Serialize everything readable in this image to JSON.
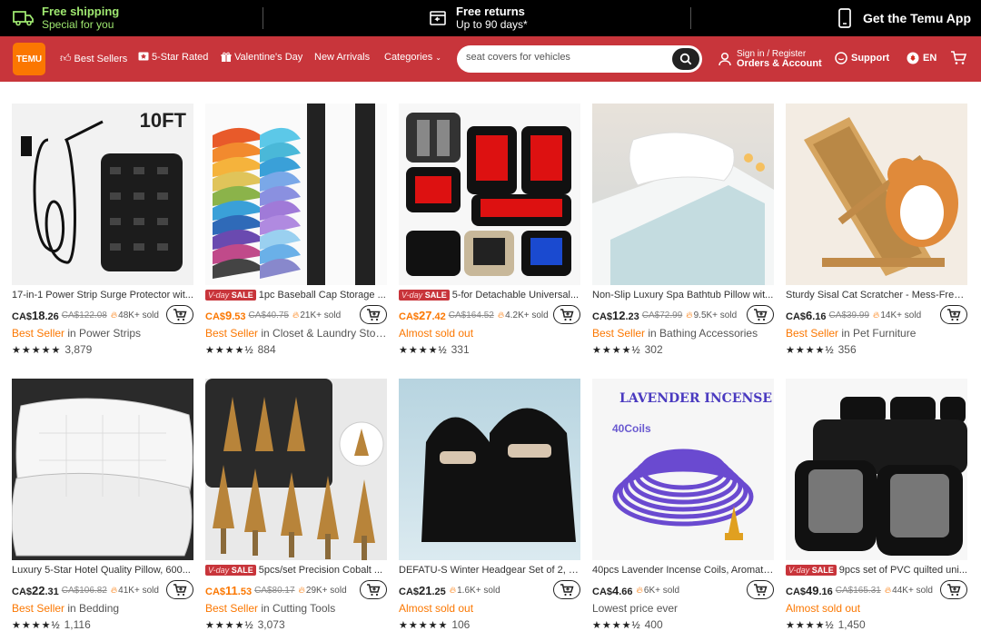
{
  "promo": {
    "shipping_title": "Free shipping",
    "shipping_sub": "Special for you",
    "returns_title": "Free returns",
    "returns_sub": "Up to 90 days*",
    "app_label": "Get the Temu App"
  },
  "nav": {
    "logo_top": "",
    "logo_bottom": "TEMU",
    "best_sellers": "Best Sellers",
    "five_star": "5-Star Rated",
    "valentines": "Valentine's Day",
    "new_arrivals": "New Arrivals",
    "categories": "Categories",
    "search_value": "seat covers for vehicles",
    "signin": "Sign in / Register",
    "orders": "Orders & Account",
    "support": "Support",
    "lang": "EN"
  },
  "colors": {
    "nav_bg": "#c8353b",
    "accent_orange": "#fb7701",
    "promo_green": "#9fe870"
  },
  "products": [
    {
      "title": "17-in-1 Power Strip Surge Protector wit...",
      "sale": false,
      "price_cur": "CA$",
      "price_main": "18",
      "price_dec": ".26",
      "price_orange": false,
      "orig": "CA$122.08",
      "sold": "48K+ sold",
      "tag_hl": "Best Seller",
      "tag_rest": " in Power Strips",
      "stars": "★★★★★",
      "reviews": "3,879",
      "rating": 5
    },
    {
      "title": "1pc Baseball Cap Storage ...",
      "sale": true,
      "price_cur": "CA$",
      "price_main": "9",
      "price_dec": ".53",
      "price_orange": true,
      "orig": "CA$40.75",
      "sold": "21K+ sold",
      "tag_hl": "Best Seller",
      "tag_rest": " in Closet & Laundry Stora...",
      "stars": "★★★★½",
      "reviews": "884",
      "rating": 4.5
    },
    {
      "title": "5-for Detachable Universal...",
      "sale": true,
      "price_cur": "CA$",
      "price_main": "27",
      "price_dec": ".42",
      "price_orange": true,
      "orig": "CA$164.52",
      "sold": "4.2K+ sold",
      "tag_hl": "Almost sold out",
      "tag_rest": "",
      "stars": "★★★★½",
      "reviews": "331",
      "rating": 4.5
    },
    {
      "title": "Non-Slip Luxury Spa Bathtub Pillow wit...",
      "sale": false,
      "price_cur": "CA$",
      "price_main": "12",
      "price_dec": ".23",
      "price_orange": false,
      "orig": "CA$72.99",
      "sold": "9.5K+ sold",
      "tag_hl": "Best Seller",
      "tag_rest": " in Bathing Accessories",
      "stars": "★★★★½",
      "reviews": "302",
      "rating": 4.5
    },
    {
      "title": "Sturdy Sisal Cat Scratcher - Mess-Free, ...",
      "sale": false,
      "price_cur": "CA$",
      "price_main": "6",
      "price_dec": ".16",
      "price_orange": false,
      "orig": "CA$39.99",
      "sold": "14K+ sold",
      "tag_hl": "Best Seller",
      "tag_rest": " in Pet Furniture",
      "stars": "★★★★½",
      "reviews": "356",
      "rating": 4.5
    },
    {
      "title": "Luxury 5-Star Hotel Quality Pillow, 600...",
      "sale": false,
      "price_cur": "CA$",
      "price_main": "22",
      "price_dec": ".31",
      "price_orange": false,
      "orig": "CA$106.82",
      "sold": "41K+ sold",
      "tag_hl": "Best Seller",
      "tag_rest": " in Bedding",
      "stars": "★★★★½",
      "reviews": "1,116",
      "rating": 4.5
    },
    {
      "title": "5pcs/set Precision Cobalt ...",
      "sale": true,
      "price_cur": "CA$",
      "price_main": "11",
      "price_dec": ".53",
      "price_orange": true,
      "orig": "CA$80.17",
      "sold": "29K+ sold",
      "tag_hl": "Best Seller",
      "tag_rest": " in Cutting Tools",
      "stars": "★★★★½",
      "reviews": "3,073",
      "rating": 4.5
    },
    {
      "title": "DEFATU-S Winter Headgear Set of 2, M...",
      "sale": false,
      "price_cur": "CA$",
      "price_main": "21",
      "price_dec": ".25",
      "price_orange": false,
      "orig": "",
      "sold": "1.6K+ sold",
      "tag_hl": "Almost sold out",
      "tag_rest": "",
      "stars": "★★★★★",
      "reviews": "106",
      "rating": 5
    },
    {
      "title": "40pcs Lavender Incense Coils, Aromatic...",
      "sale": false,
      "price_cur": "CA$",
      "price_main": "4",
      "price_dec": ".66",
      "price_orange": false,
      "orig": "",
      "sold": "6K+ sold",
      "tag_hl": "",
      "tag_rest": "Lowest price ever",
      "stars": "★★★★½",
      "reviews": "400",
      "rating": 4.5
    },
    {
      "title": "9pcs set of PVC quilted uni...",
      "sale": true,
      "price_cur": "CA$",
      "price_main": "49",
      "price_dec": ".16",
      "price_orange": false,
      "orig": "CA$165.31",
      "sold": "44K+ sold",
      "tag_hl": "Almost sold out",
      "tag_rest": "",
      "stars": "★★★★½",
      "reviews": "1,450",
      "rating": 4.5
    }
  ],
  "sale_badge": {
    "script": "V-day",
    "word": "SALE"
  },
  "image_text": {
    "power_strip": "10FT",
    "incense_title": "LAVENDER INCENSE",
    "incense_coils": "40Coils"
  }
}
